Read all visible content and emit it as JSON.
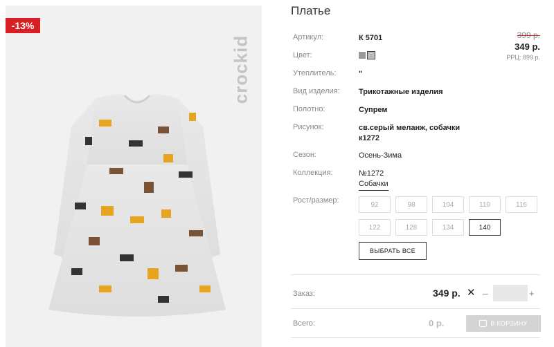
{
  "product": {
    "discount_badge": "-13%",
    "brand": "crockid",
    "title": "Платье",
    "old_price": "399 р.",
    "new_price": "349 р.",
    "rrp": "РРЦ: 899 р."
  },
  "specs": [
    {
      "label": "Артикул:",
      "value": "К 5701"
    },
    {
      "label": "Цвет:",
      "value": ""
    },
    {
      "label": "Утеплитель:",
      "value": "\""
    },
    {
      "label": "Вид изделия:",
      "value": "Трикотажные изделия"
    },
    {
      "label": "Полотно:",
      "value": "Супрем"
    },
    {
      "label": "Рисунок:",
      "value": "св.серый меланж, собачки к1272"
    },
    {
      "label": "Сезон:",
      "value": "Осень-Зима"
    },
    {
      "label": "Коллекция:",
      "value": "№1272 Собачки"
    }
  ],
  "colors": [
    "#9a9a9a",
    "#bdbdbd"
  ],
  "size_label": "Рост/размер:",
  "sizes": [
    "92",
    "98",
    "104",
    "110",
    "116",
    "122",
    "128",
    "134",
    "140"
  ],
  "selected_size": "140",
  "select_all_label": "ВЫБРАТЬ ВСЕ",
  "order": {
    "label": "Заказ:",
    "price": "349 р.",
    "times": "✕",
    "minus": "–",
    "plus": "+",
    "qty": ""
  },
  "total": {
    "label": "Всего:",
    "value": "0 р.",
    "cart_label": "В КОРЗИНУ"
  }
}
